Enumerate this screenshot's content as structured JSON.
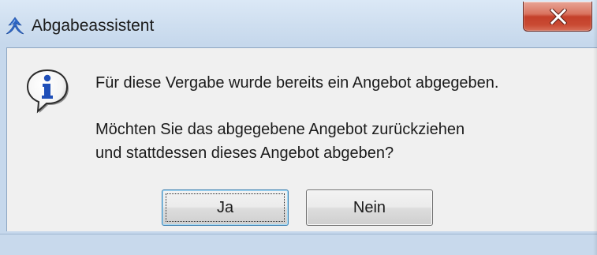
{
  "window": {
    "title": "Abgabeassistent",
    "app_icon": "app-logo-icon",
    "close_icon": "close-icon"
  },
  "dialog": {
    "icon": "info-icon",
    "message_line1": "Für diese Vergabe wurde bereits ein Angebot abgegeben.",
    "message_line2": "Möchten Sie das abgegebene Angebot zurückziehen",
    "message_line3": "und stattdessen dieses Angebot abgeben?"
  },
  "buttons": {
    "yes_label": "Ja",
    "no_label": "Nein",
    "focused": "Ja"
  },
  "colors": {
    "info_blue": "#1f4fb8",
    "close_red": "#c4402a",
    "focus_border": "#3c7fb1"
  }
}
